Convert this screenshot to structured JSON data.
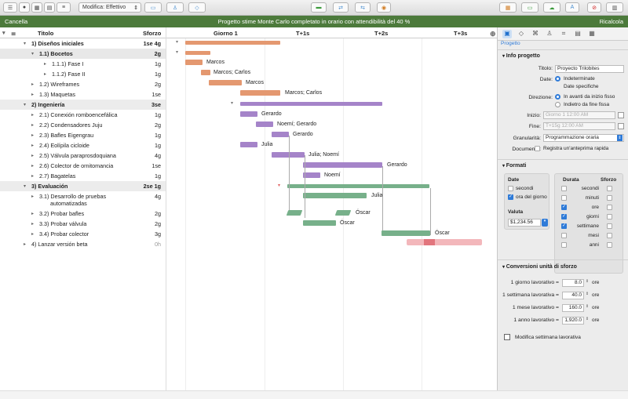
{
  "toolbar": {
    "view_select": "Modifica: Effettivo"
  },
  "status": {
    "cancel": "Cancella",
    "message": "Progetto stime Monte Carlo completato in orario con attendibilità del 40 %",
    "recalc": "Ricalcola"
  },
  "outline": {
    "col_title": "Titolo",
    "col_effort": "Sforzo",
    "rows": [
      {
        "id": "1)",
        "name": "Diseños iniciales",
        "effort": "1se 4g",
        "group": true,
        "level": 0,
        "expanded": true
      },
      {
        "id": "1.1)",
        "name": "Bocetos",
        "effort": "2g",
        "group": true,
        "level": 1,
        "expanded": true
      },
      {
        "id": "1.1.1)",
        "name": "Fase I",
        "effort": "1g",
        "group": false,
        "level": 2
      },
      {
        "id": "1.1.2)",
        "name": "Fase II",
        "effort": "1g",
        "group": false,
        "level": 2
      },
      {
        "id": "1.2)",
        "name": "Wireframes",
        "effort": "2g",
        "group": false,
        "level": 1
      },
      {
        "id": "1.3)",
        "name": "Maquetas",
        "effort": "1se",
        "group": false,
        "level": 1
      },
      {
        "id": "2)",
        "name": "Ingeniería",
        "effort": "3se",
        "group": true,
        "level": 0,
        "expanded": true
      },
      {
        "id": "2.1)",
        "name": "Conexión romboencefálica",
        "effort": "1g",
        "group": false,
        "level": 1
      },
      {
        "id": "2.2)",
        "name": "Condensadores Juju",
        "effort": "2g",
        "group": false,
        "level": 1
      },
      {
        "id": "2.3)",
        "name": "Bafles Eigengrau",
        "effort": "1g",
        "group": false,
        "level": 1
      },
      {
        "id": "2.4)",
        "name": "Eolípila cicloide",
        "effort": "1g",
        "group": false,
        "level": 1
      },
      {
        "id": "2.5)",
        "name": "Válvula paraprosdoquiana",
        "effort": "4g",
        "group": false,
        "level": 1
      },
      {
        "id": "2.6)",
        "name": "Colector de ornitomancia",
        "effort": "1se",
        "group": false,
        "level": 1
      },
      {
        "id": "2.7)",
        "name": "Bagatelas",
        "effort": "1g",
        "group": false,
        "level": 1
      },
      {
        "id": "3)",
        "name": "Evaluación",
        "effort": "2se 1g",
        "group": true,
        "level": 0,
        "expanded": true
      },
      {
        "id": "3.1)",
        "name": "Desarrollo de pruebas automatizadas",
        "name_line1": "Desarrollo de pruebas",
        "name_line2": "automatizadas",
        "effort": "4g",
        "group": false,
        "level": 1,
        "tall": true
      },
      {
        "id": "3.2)",
        "name": "Probar bafles",
        "effort": "2g",
        "group": false,
        "level": 1
      },
      {
        "id": "3.3)",
        "name": "Probar válvula",
        "effort": "2g",
        "group": false,
        "level": 1
      },
      {
        "id": "3.4)",
        "name": "Probar colector",
        "effort": "3g",
        "group": false,
        "level": 1
      },
      {
        "id": "4)",
        "name": "Lanzar versión beta",
        "effort": "0h",
        "group": false,
        "level": 0
      }
    ]
  },
  "gantt": {
    "headers": [
      "Giorno 1",
      "T+1s",
      "T+2s",
      "T+3s"
    ],
    "labels": {
      "fase1": "Marcos",
      "fase2": "Marcos; Carlos",
      "wire": "Marcos",
      "maq": "Marcos; Carlos",
      "e21": "Gerardo",
      "e22": "Noemí; Gerardo",
      "e23": "Gerardo",
      "e24": "Julia",
      "e25": "Julia; Noemí",
      "e26": "Gerardo",
      "e27": "Noemí",
      "t31": "Julia",
      "t32": "Óscar",
      "t33": "Óscar",
      "t34": "Óscar"
    }
  },
  "inspector": {
    "subtitle": "Progetto",
    "info_title": "Info progetto",
    "title_label": "Titolo:",
    "title_value": "Proyecto Trilobites",
    "date_label": "Date:",
    "date_opt1": "Indeterminate",
    "date_opt2": "Date specifiche",
    "dir_label": "Direzione:",
    "dir_opt1": "In avanti da inizio fisso",
    "dir_opt2": "Indietro da fine fissa",
    "start_label": "Inizio:",
    "start_value": "Giorno 1 12:00 AM",
    "end_label": "Fine:",
    "end_value": "T+15g 12:00 AM",
    "gran_label": "Granularità:",
    "gran_value": "Programmazione oraria",
    "doc_label": "Documento:",
    "doc_check": "Registra un'anteprima rapida",
    "formats_title": "Formati",
    "date_panel_title": "Date",
    "date_seconds": "secondi",
    "date_time": "ora del giorno",
    "currency_title": "Valuta",
    "currency_value": "$1,234.56",
    "dur_title": "Durata",
    "eff_title": "Sforzo",
    "units": [
      {
        "name": "secondi",
        "dur": false,
        "eff": false
      },
      {
        "name": "minuti",
        "dur": false,
        "eff": false
      },
      {
        "name": "ore",
        "dur": true,
        "eff": false
      },
      {
        "name": "giorni",
        "dur": true,
        "eff": false
      },
      {
        "name": "settimane",
        "dur": true,
        "eff": false
      },
      {
        "name": "mesi",
        "dur": false,
        "eff": false
      },
      {
        "name": "anni",
        "dur": false,
        "eff": false
      }
    ],
    "conv_title": "Conversioni unità di sforzo",
    "conversions": [
      {
        "label": "1 giorno lavorativo =",
        "value": "8.0",
        "unit": "ore"
      },
      {
        "label": "1 settimana lavorativa =",
        "value": "40.0",
        "unit": "ore"
      },
      {
        "label": "1 mese lavorativo =",
        "value": "160.0",
        "unit": "ore"
      },
      {
        "label": "1 anno lavorativo =",
        "value": "1,920.0",
        "unit": "ore"
      }
    ],
    "week_button": "Modifica settimana lavorativa"
  }
}
